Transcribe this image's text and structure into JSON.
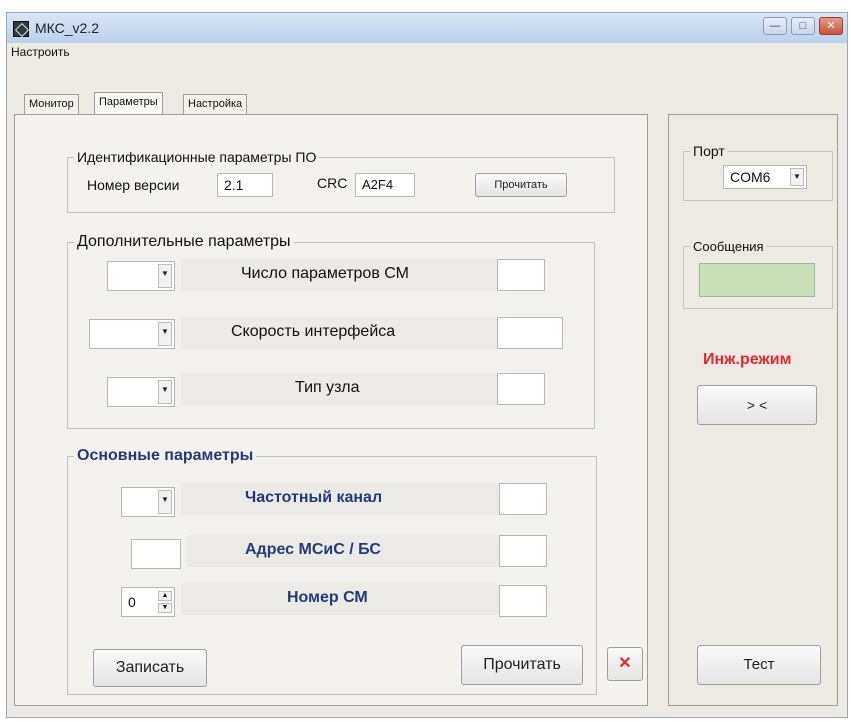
{
  "window": {
    "title": "МКС_v2.2"
  },
  "menu": {
    "item": "Настроить"
  },
  "tabs": [
    {
      "label": "Монитор"
    },
    {
      "label": "Параметры"
    },
    {
      "label": "Настройка"
    }
  ],
  "id_section": {
    "title": "Идентификационные параметры ПО",
    "version_label": "Номер версии",
    "version_value": "2.1",
    "crc_label": "CRC",
    "crc_value": "A2F4",
    "read_button": "Прочитать"
  },
  "extra_section": {
    "title": "Дополнительные параметры",
    "rows": [
      {
        "label": "Число параметров СМ"
      },
      {
        "label": "Скорость интерфейса"
      },
      {
        "label": "Тип узла"
      }
    ]
  },
  "main_section": {
    "title": "Основные параметры",
    "rows": [
      {
        "label": "Частотный канал"
      },
      {
        "label": "Адрес МСиС / БС"
      },
      {
        "label": "Номер СМ"
      }
    ],
    "spin_value": "0"
  },
  "actions": {
    "write": "Записать",
    "read": "Прочитать",
    "close_symbol": "✕"
  },
  "port": {
    "title": "Порт",
    "value": "COM6"
  },
  "messages": {
    "title": "Сообщения"
  },
  "engineer": {
    "label": "Инж.режим",
    "button": "> <"
  },
  "test_button": "Тест",
  "colors": {
    "accent_red": "#e8262d",
    "message_box": "#c9e0ba"
  }
}
